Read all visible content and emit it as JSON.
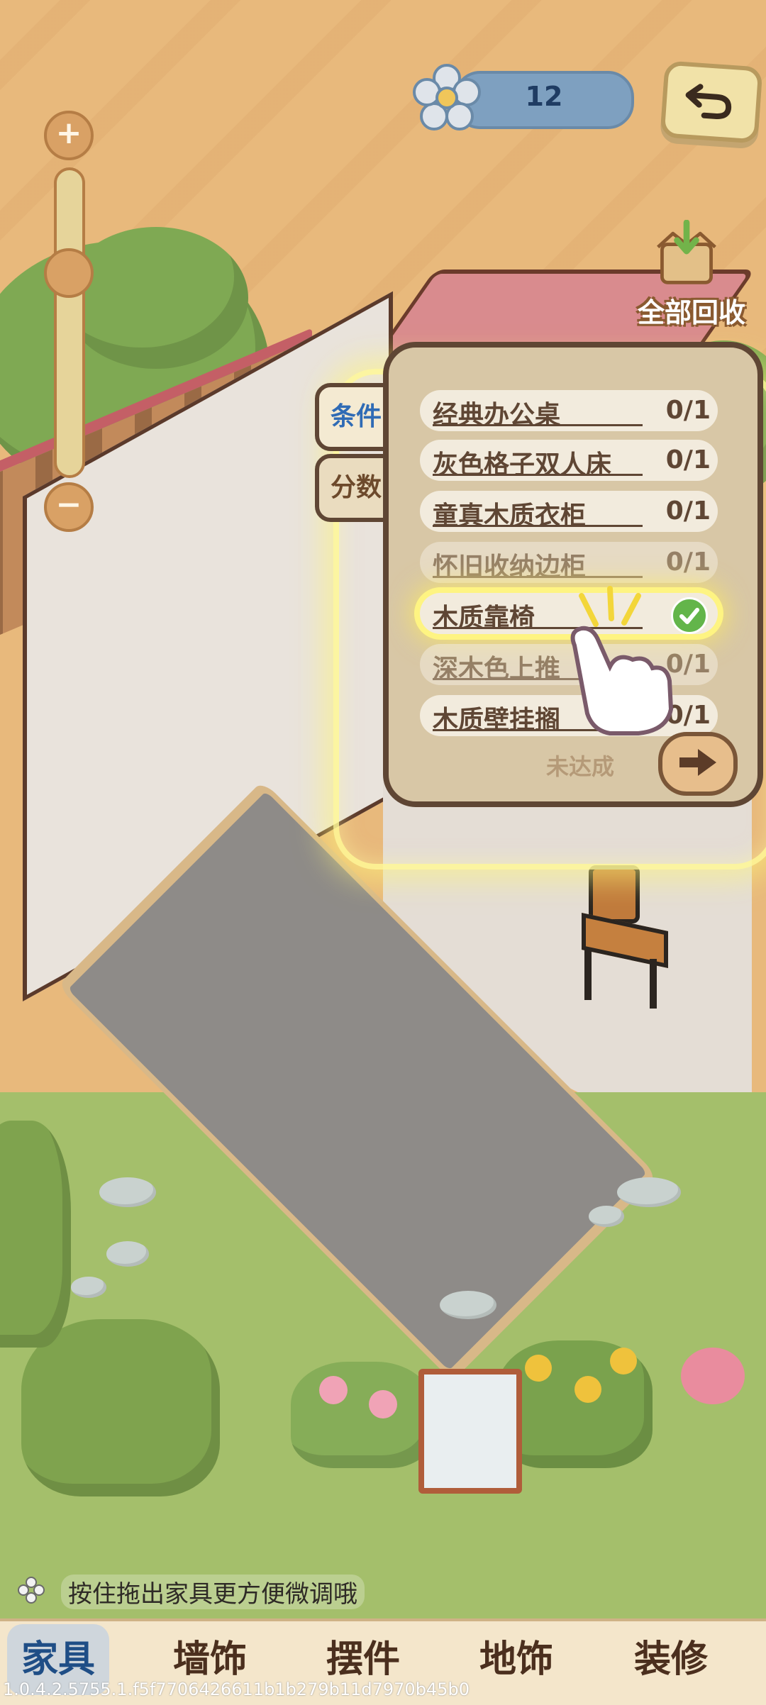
{
  "currency": {
    "value": "12",
    "icon": "flower-icon"
  },
  "recycle": {
    "label": "全部回收",
    "icon": "box-recycle-icon"
  },
  "zoom": {
    "plus": "+",
    "minus": "−"
  },
  "panel": {
    "tabs": [
      {
        "label": "条件",
        "active": true
      },
      {
        "label": "分数",
        "active": false
      }
    ],
    "conditions": [
      {
        "name": "经典办公桌",
        "count": "0/1"
      },
      {
        "name": "灰色格子双人床",
        "count": "0/1"
      },
      {
        "name": "童真木质衣柜",
        "count": "0/1"
      },
      {
        "name": "怀旧收纳边柜",
        "count": "0/1"
      },
      {
        "name": "木质靠椅",
        "count": "",
        "completed": true
      },
      {
        "name": "深木色上推",
        "count": "0/1"
      },
      {
        "name": "木质壁挂搁",
        "count": "0/1"
      }
    ],
    "status": "未达成"
  },
  "hint": "按住拖出家具更方便微调哦",
  "nav": {
    "tabs": [
      {
        "label": "家具",
        "active": true
      },
      {
        "label": "墙饰",
        "active": false
      },
      {
        "label": "摆件",
        "active": false
      },
      {
        "label": "地饰",
        "active": false
      },
      {
        "label": "装修",
        "active": false
      }
    ]
  },
  "version": "1.0.4.2.5755.1.f5f7706426611b1b279b11d7970b45b0",
  "colors": {
    "accent": "#2f6bb5",
    "panel_bg": "#d8c7a6",
    "highlight": "#fff682",
    "check": "#63b54a"
  }
}
